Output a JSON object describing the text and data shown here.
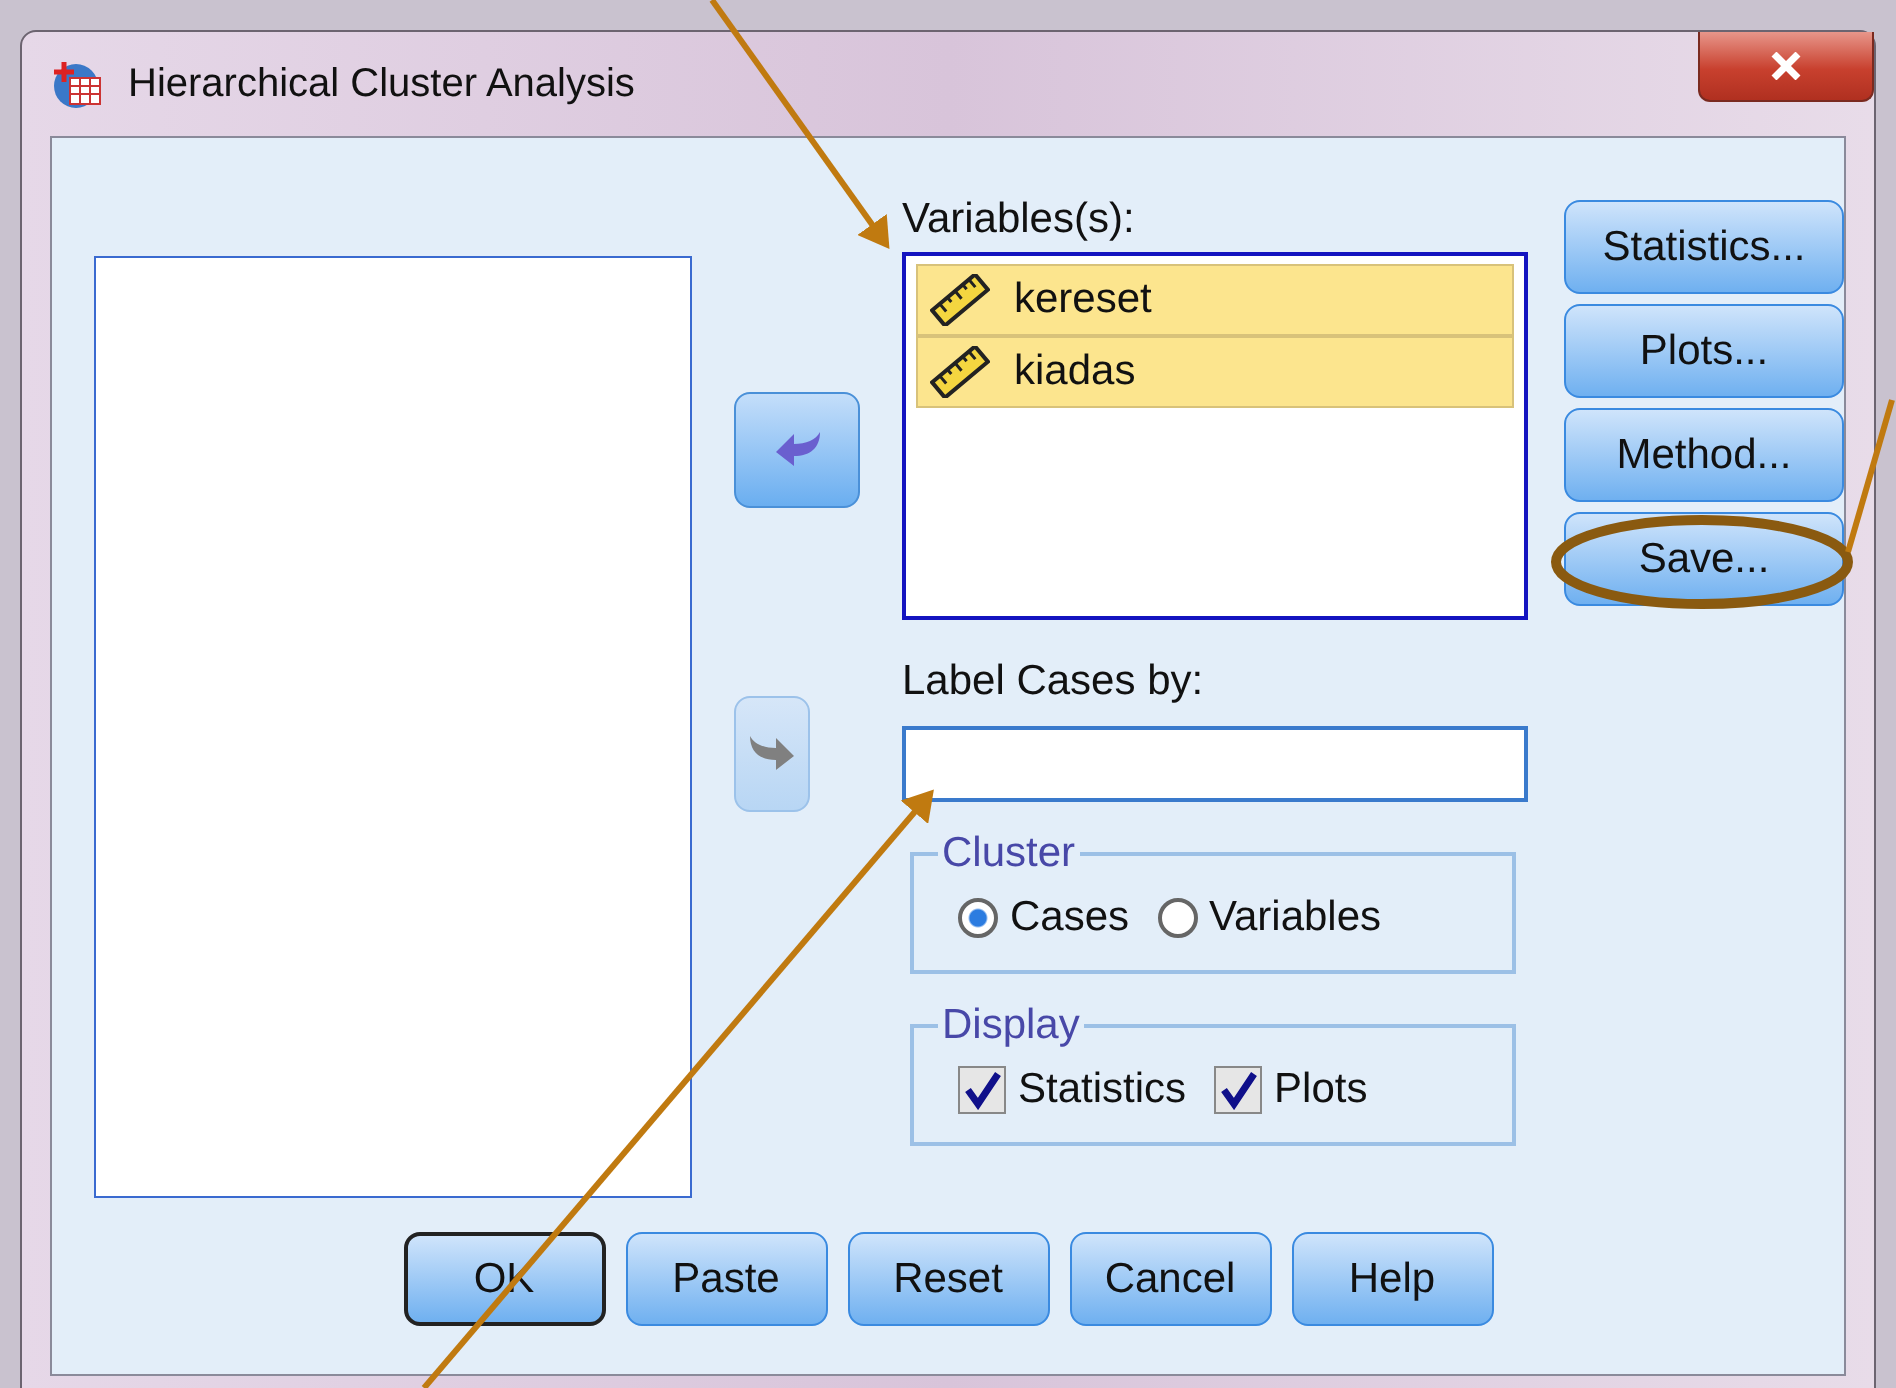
{
  "window": {
    "title": "Hierarchical Cluster Analysis"
  },
  "move_buttons": [
    {
      "kind": "into",
      "disabled": false
    },
    {
      "kind": "out",
      "disabled": true
    }
  ],
  "variables": {
    "label": "Variables(s):",
    "items": [
      {
        "name": "kereset",
        "selected": true
      },
      {
        "name": "kiadas",
        "selected": true
      }
    ]
  },
  "side_buttons": [
    "Statistics...",
    "Plots...",
    "Method...",
    "Save..."
  ],
  "label_cases": {
    "label": "Label Cases by:"
  },
  "cluster": {
    "title": "Cluster",
    "options": [
      {
        "label": "Cases",
        "selected": true
      },
      {
        "label": "Variables",
        "selected": false
      }
    ]
  },
  "display": {
    "title": "Display",
    "options": [
      {
        "label": "Statistics",
        "checked": true
      },
      {
        "label": "Plots",
        "checked": true
      }
    ]
  },
  "buttons": [
    {
      "label": "OK",
      "default": true
    },
    {
      "label": "Paste",
      "default": false
    },
    {
      "label": "Reset",
      "default": false
    },
    {
      "label": "Cancel",
      "default": false
    },
    {
      "label": "Help",
      "default": false
    }
  ]
}
